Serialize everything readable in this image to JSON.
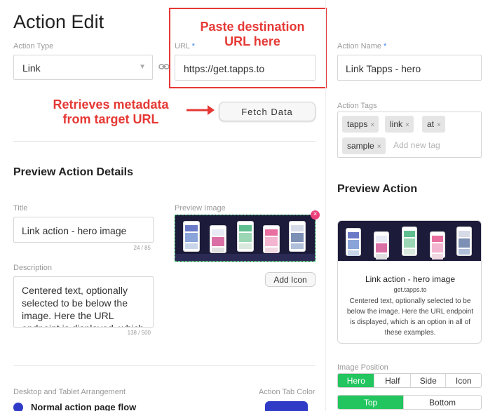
{
  "page": {
    "title": "Action Edit"
  },
  "action_type": {
    "label": "Action Type",
    "value": "Link"
  },
  "url": {
    "label": "URL",
    "required_mark": "*",
    "value": "https://get.tapps.to"
  },
  "action_name": {
    "label": "Action Name",
    "required_mark": "*",
    "value": "Link Tapps - hero"
  },
  "annotations": {
    "paste_destination": "Paste destination URL here",
    "retrieves_metadata": "Retrieves metadata from target URL",
    "arrow": "➜"
  },
  "fetch_button": {
    "label": "Fetch Data"
  },
  "action_tags": {
    "label": "Action Tags",
    "tags": [
      "tapps",
      "link",
      "at",
      "sample"
    ],
    "remove_glyph": "×",
    "placeholder": "Add new tag"
  },
  "preview_details": {
    "title": "Preview Action Details",
    "title_field": {
      "label": "Title",
      "value": "Link action - hero image",
      "counter": "24 / 85"
    },
    "description_field": {
      "label": "Description",
      "value": "Centered text, optionally selected to be below the image. Here the URL endpoint is displayed, which is an option in all of these examples.",
      "counter": "138 / 500"
    },
    "preview_image": {
      "label": "Preview Image",
      "remove_glyph": "×"
    },
    "add_icon_button": "Add Icon"
  },
  "preview_action": {
    "title": "Preview Action",
    "card_title": "Link action - hero image",
    "card_domain": "get.tapps.to",
    "card_description": "Centered text, optionally selected to be below the image. Here the URL endpoint is displayed, which is an option in all of these examples."
  },
  "image_position": {
    "label": "Image Position",
    "options": [
      "Hero",
      "Half",
      "Side",
      "Icon"
    ],
    "selected": "Hero"
  },
  "text_position": {
    "options": [
      "Top",
      "Bottom"
    ],
    "selected": "Top"
  },
  "arrangement": {
    "label": "Desktop and Tablet Arrangement",
    "option_normal": "Normal action page flow"
  },
  "action_tab_color": {
    "label": "Action Tab Color",
    "color": "#2f3bc7"
  },
  "colors": {
    "accent_red": "#e53935",
    "active_green": "#22c55e",
    "hero_bg": "#1c1b3a"
  },
  "icons": {
    "dropdown": "chevron-down-icon",
    "link": "link-icon",
    "remove": "close-icon",
    "arrow": "arrow-right-icon"
  }
}
